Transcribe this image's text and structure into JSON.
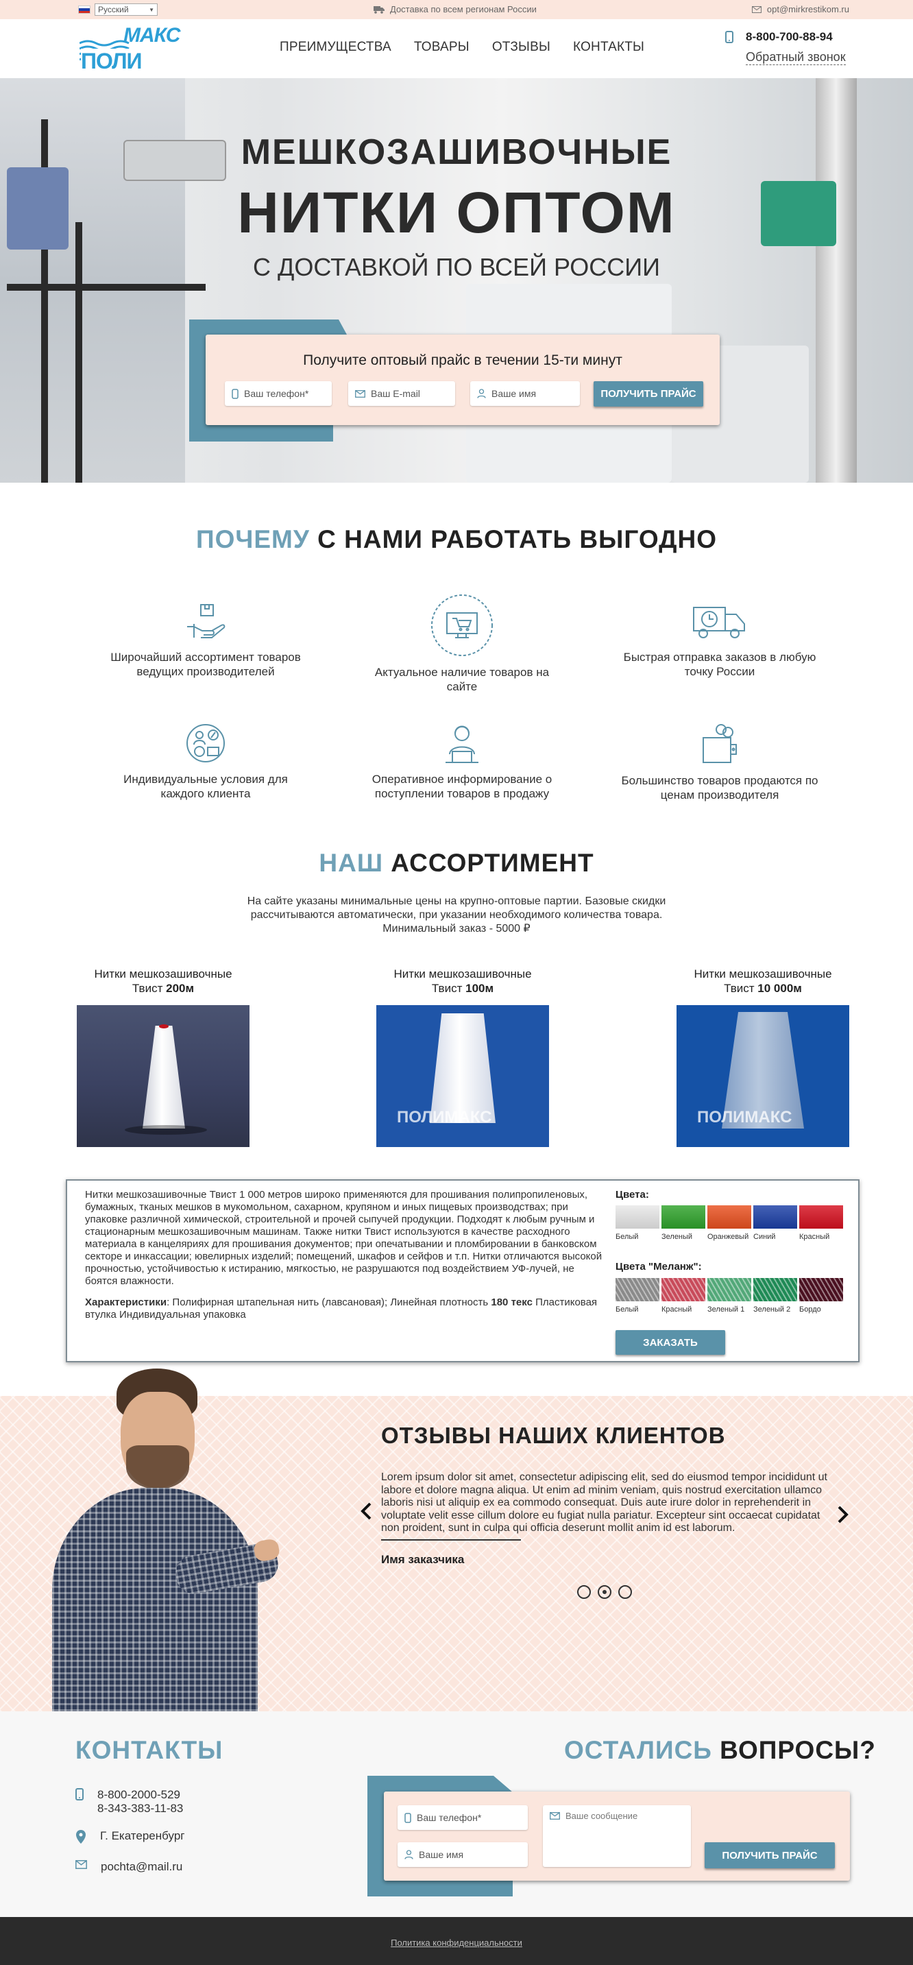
{
  "topbar": {
    "language": "Русский",
    "delivery": "Доставка по всем регионам России",
    "email": "opt@mirkrestikom.ru"
  },
  "header": {
    "logo_line1": "МАКС",
    "logo_line2": "ПОЛИ",
    "nav": [
      "ПРЕИМУЩЕСТВА",
      "ТОВАРЫ",
      "ОТЗЫВЫ",
      "КОНТАКТЫ"
    ],
    "phone": "8-800-700-88-94",
    "callback": "Обратный звонок"
  },
  "hero": {
    "title1": "МЕШКОЗАШИВОЧНЫЕ",
    "title2": "НИТКИ ОПТОМ",
    "subtitle": "С ДОСТАВКОЙ ПО ВСЕЙ РОССИИ",
    "form_title": "Получите оптовый прайс в течении 15-ти минут",
    "phone_placeholder": "Ваш телефон*",
    "email_placeholder": "Ваш E-mail",
    "name_placeholder": "Ваше имя",
    "button": "ПОЛУЧИТЬ ПРАЙС"
  },
  "why": {
    "title_hl": "ПОЧЕМУ",
    "title_rest": " С НАМИ РАБОТАТЬ ВЫГОДНО",
    "features": [
      {
        "icon": "hand-box-icon",
        "text": "Широчайший ассортимент товаров ведущих производителей"
      },
      {
        "icon": "monitor-cart-icon",
        "text": "Актуальное наличие товаров на сайте"
      },
      {
        "icon": "truck-clock-icon",
        "text": "Быстрая отправка заказов в любую точку России"
      },
      {
        "icon": "people-percent-icon",
        "text": "Индивидуальные условия для каждого клиента"
      },
      {
        "icon": "operator-laptop-icon",
        "text": "Оперативное информирование о поступлении товаров в продажу"
      },
      {
        "icon": "wallet-coins-icon",
        "text": "Большинство товаров продаются по ценам производителя"
      }
    ]
  },
  "assortment": {
    "title_hl": "НАШ",
    "title_rest": " АССОРТИМЕНТ",
    "intro": "На сайте указаны минимальные цены на крупно-оптовые партии. Базовые скидки рассчитываются автоматически, при указании необходимого количества товара. Минимальный заказ - 5000 ₽",
    "products": [
      {
        "name": "Нитки мешкозашивочные",
        "type": "Твист ",
        "length": "200м"
      },
      {
        "name": "Нитки мешкозашивочные",
        "type": "Твист ",
        "length": "100м"
      },
      {
        "name": "Нитки мешкозашивочные",
        "type": "Твист ",
        "length": "10 000м"
      }
    ],
    "description": "Нитки мешкозашивочные Твист 1 000 метров широко применяются для прошивания полипропиленовых, бумажных, тканых мешков в мукомольном, сахарном, крупяном и иных пищевых производствах; при упаковке различной химической, строительной и прочей сыпучей продукции. Подходят к любым ручным и стационарным мешкозашивочным машинам. Также нитки Твист используются в качестве расходного материала в канцеляриях для прошивания документов; при опечатывании и пломбировании в банковском секторе и инкассации; ювелирных изделий; помещений, шкафов и сейфов и т.п. Нитки отличаются высокой прочностью, устойчивостью к истиранию, мягкостью, не разрушаются под воздействием УФ-лучей, не боятся влажности.",
    "char_label": "Характеристики",
    "char_text1": ": Полифирная штапельная нить (лавсановая); Линейная плотность ",
    "char_bold": "180 текс",
    "char_text2": " Пластиковая втулка Индивидуальная упаковка",
    "colors_title": "Цвета:",
    "colors": [
      {
        "label": "Белый",
        "hex": "#e8e8e8"
      },
      {
        "label": "Зеленый",
        "hex": "#2fa32b"
      },
      {
        "label": "Оранжевый",
        "hex": "#e9501f"
      },
      {
        "label": "Синий",
        "hex": "#1b3fa6"
      },
      {
        "label": "Красный",
        "hex": "#d6101f"
      }
    ],
    "melange_title": "Цвета \"Меланж\":",
    "melange": [
      {
        "label": "Белый",
        "hex": "#8a8a8a"
      },
      {
        "label": "Красный",
        "hex": "#c84a5a"
      },
      {
        "label": "Зеленый 1",
        "hex": "#52a878"
      },
      {
        "label": "Зеленый 2",
        "hex": "#1f8a55"
      },
      {
        "label": "Бордо",
        "hex": "#4a1020"
      }
    ],
    "order_button": "ЗАКАЗАТЬ"
  },
  "reviews": {
    "title": "ОТЗЫВЫ НАШИХ КЛИЕНТОВ",
    "text": "Lorem ipsum dolor sit amet, consectetur adipiscing elit, sed do eiusmod tempor incididunt ut labore et dolore magna aliqua. Ut enim ad minim veniam, quis nostrud exercitation ullamco laboris nisi ut aliquip ex ea commodo consequat. Duis aute irure dolor in reprehenderit in voluptate velit esse cillum dolore eu fugiat nulla pariatur. Excepteur sint occaecat cupidatat non proident, sunt in culpa qui officia deserunt mollit anim id est laborum.",
    "author": "Имя заказчика",
    "active_slide": 2
  },
  "contacts": {
    "title": "КОНТАКТЫ",
    "phone1": "8-800-2000-529",
    "phone2": "8-343-383-11-83",
    "city": "Г. Екатеренбург",
    "email": "pochta@mail.ru",
    "q_title_hl": "ОСТАЛИСЬ",
    "q_title_rest": " ВОПРОСЫ?",
    "phone_placeholder": "Ваш телефон*",
    "name_placeholder": "Ваше имя",
    "message_placeholder": "Ваше сообщение",
    "button": "ПОЛУЧИТЬ ПРАЙС"
  },
  "footer": {
    "policy": "Политика конфиденциальности"
  },
  "colors": {
    "accent": "#5a92a9",
    "title_hl": "#6fa0b6",
    "peach": "#fbe6dd",
    "dark": "#2b2b2b"
  }
}
